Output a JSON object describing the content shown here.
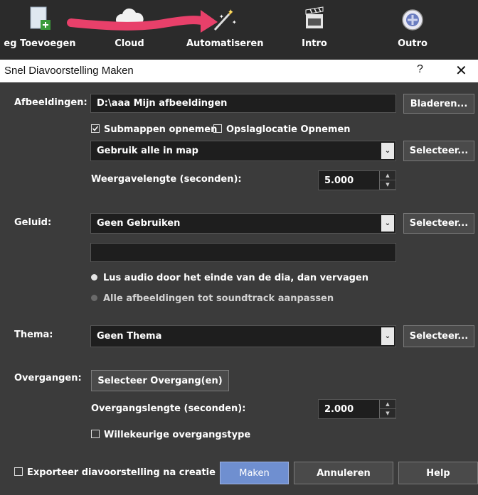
{
  "toolbar": {
    "items": [
      {
        "label": "eg Toevoegen",
        "icon": "add-image-icon"
      },
      {
        "label": "Cloud",
        "icon": "cloud-icon"
      },
      {
        "label": "Automatiseren",
        "icon": "magic-wand-icon"
      },
      {
        "label": "Intro",
        "icon": "clapperboard-icon"
      },
      {
        "label": "Outro",
        "icon": "film-reel-icon"
      }
    ],
    "arrow_color": "#e8406a"
  },
  "dialog": {
    "title": "Snel Diavoorstelling Maken",
    "help_glyph": "?",
    "close_glyph": "✕",
    "images": {
      "label": "Afbeeldingen:",
      "path": "D:\\aaa Mijn afbeeldingen",
      "browse_label": "Bladeren...",
      "subfolders_label": "Submappen opnemen",
      "subfolders_checked": true,
      "storage_location_label": "Opslaglocatie Opnemen",
      "storage_location_checked": false,
      "mode_value": "Gebruik alle in map",
      "select_label": "Selecteer...",
      "duration_label": "Weergavelengte (seconden):",
      "duration_value": "5.000"
    },
    "sound": {
      "label": "Geluid:",
      "value": "Geen Gebruiken",
      "select_label": "Selecteer...",
      "text_value": "",
      "radio_loop_label": "Lus audio door het einde van de dia, dan vervagen",
      "radio_fit_label": "Alle afbeeldingen tot soundtrack aanpassen",
      "selected_radio": "loop"
    },
    "theme": {
      "label": "Thema:",
      "value": "Geen Thema",
      "select_label": "Selecteer..."
    },
    "transitions": {
      "label": "Overgangen:",
      "button_label": "Selecteer Overgang(en)",
      "length_label": "Overgangslengte (seconden):",
      "length_value": "2.000",
      "random_label": "Willekeurige overgangstype",
      "random_checked": false
    },
    "footer": {
      "export_label": "Exporteer diavoorstelling na creatie",
      "export_checked": false,
      "make_label": "Maken",
      "cancel_label": "Annuleren",
      "help_label": "Help"
    }
  }
}
